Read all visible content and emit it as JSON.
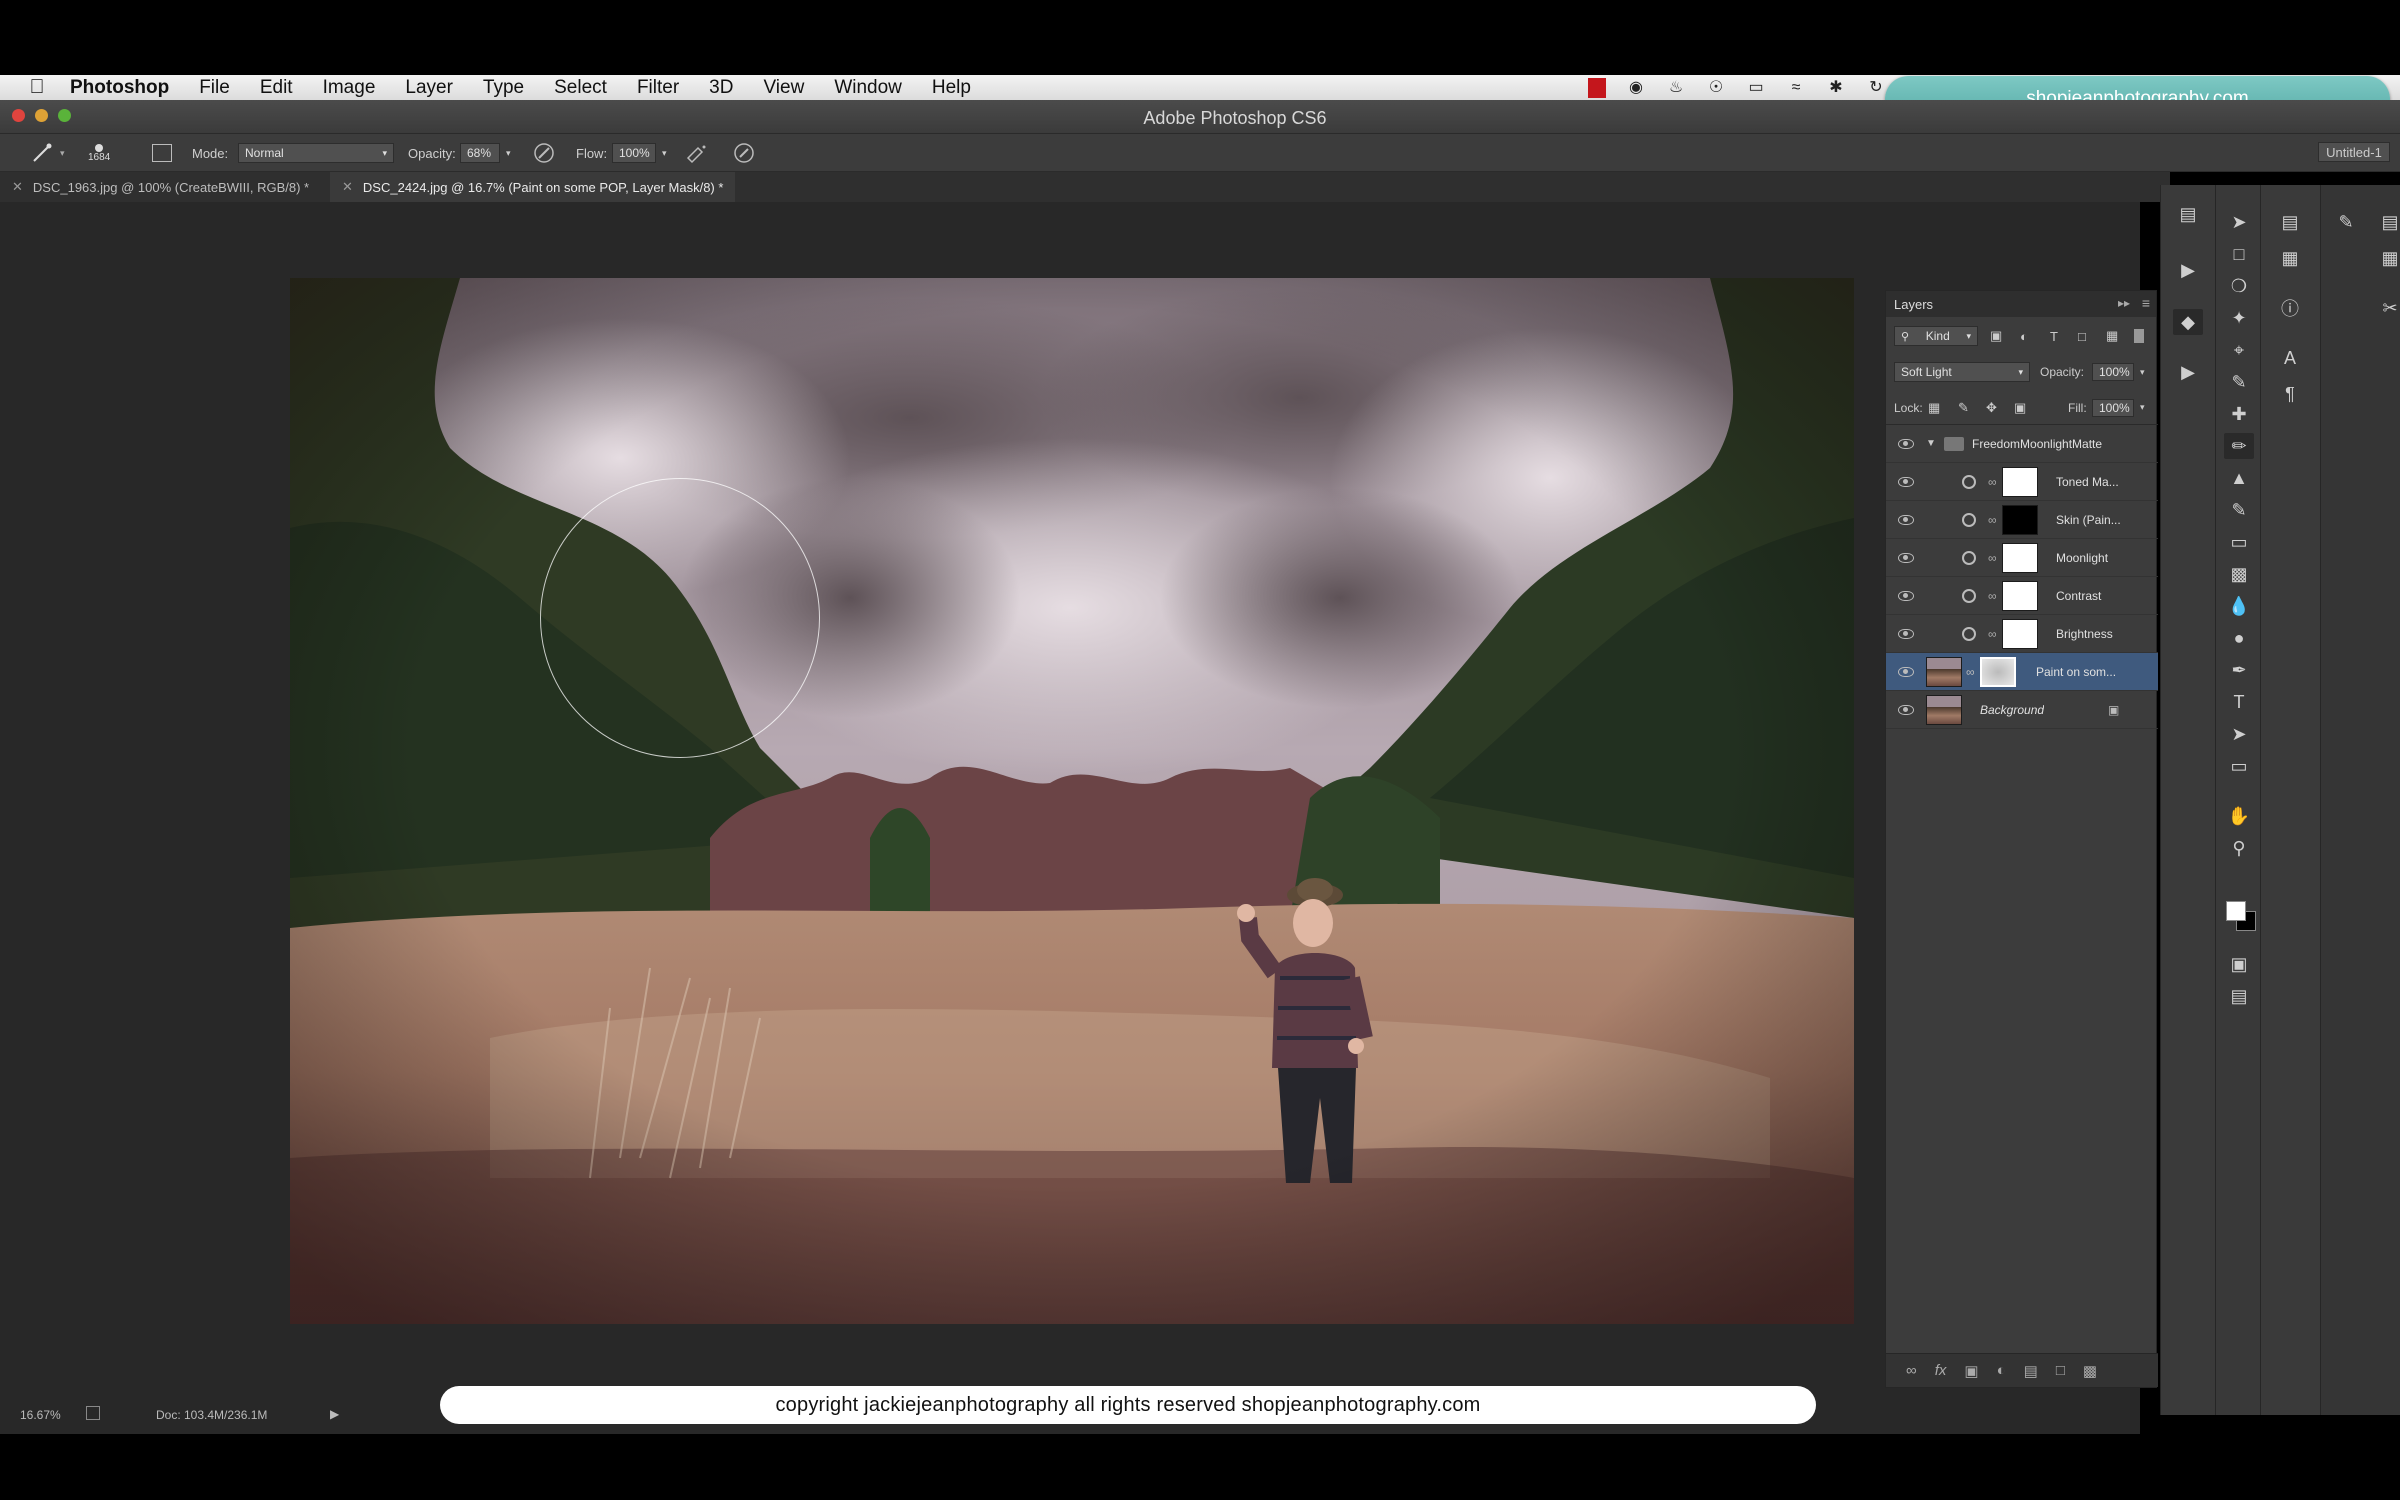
{
  "menubar": {
    "app": "Photoshop",
    "items": [
      "File",
      "Edit",
      "Image",
      "Layer",
      "Type",
      "Select",
      "Filter",
      "3D",
      "View",
      "Window",
      "Help"
    ]
  },
  "overlay": {
    "watermark_url": "shopjeanphotography.com",
    "copyright": "copyright jackiejeanphotography all rights reserved shopjeanphotography.com"
  },
  "window": {
    "title": "Adobe Photoshop CS6"
  },
  "options": {
    "brush_size": "1684",
    "mode_label": "Mode:",
    "mode_value": "Normal",
    "opacity_label": "Opacity:",
    "opacity_value": "68%",
    "flow_label": "Flow:",
    "flow_value": "100%",
    "workspace": "Untitled-1"
  },
  "tabs": [
    {
      "label": "DSC_1963.jpg @ 100% (CreateBWIII, RGB/8) *",
      "active": false
    },
    {
      "label": "DSC_2424.jpg @ 16.7% (Paint on some POP, Layer Mask/8) *",
      "active": true
    }
  ],
  "status": {
    "zoom": "16.67%",
    "doc": "Doc: 103.4M/236.1M"
  },
  "layers_panel": {
    "title": "Layers",
    "filter_kind": "Kind",
    "blend_mode": "Soft Light",
    "opacity_label": "Opacity:",
    "opacity_value": "100%",
    "lock_label": "Lock:",
    "fill_label": "Fill:",
    "fill_value": "100%",
    "group_name": "FreedomMoonlightMatte",
    "layers": [
      {
        "name": "Toned Ma...",
        "mask": "#ffffff"
      },
      {
        "name": "Skin (Pain...",
        "mask": "#000000"
      },
      {
        "name": "Moonlight",
        "mask": "#ffffff"
      },
      {
        "name": "Contrast",
        "mask": "#ffffff"
      },
      {
        "name": "Brightness",
        "mask": "#ffffff"
      },
      {
        "name": "Paint on som...",
        "selected": true
      },
      {
        "name": "Background"
      }
    ]
  },
  "colors": {
    "accent_pill": "#62b5b0",
    "selection": "#3f5a7e"
  }
}
